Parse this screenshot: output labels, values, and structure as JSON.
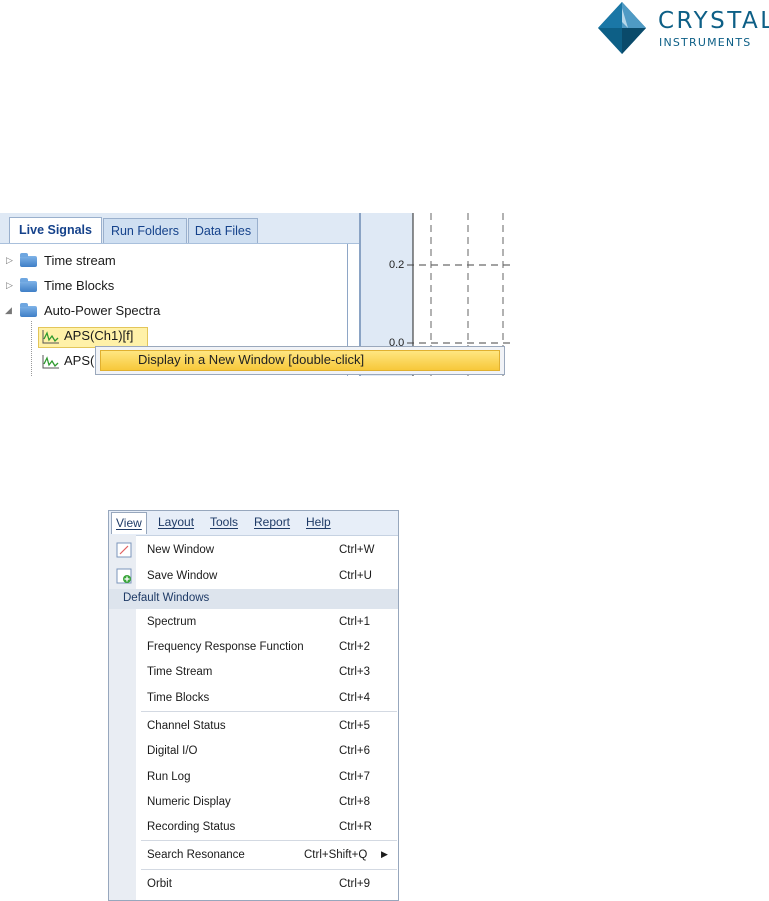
{
  "logo": {
    "line1": "CRYSTAL",
    "line2": "INSTRUMENTS"
  },
  "tree_panel": {
    "tabs": [
      "Live Signals",
      "Run Folders",
      "Data Files"
    ],
    "active_tab": "Live Signals",
    "items": [
      {
        "label": "Time stream",
        "expander": "▷"
      },
      {
        "label": "Time Blocks",
        "expander": "▷"
      },
      {
        "label": "Auto-Power Spectra",
        "expander": "◢"
      },
      {
        "label": "APS(Ch1)[f]"
      },
      {
        "label": "APS("
      }
    ],
    "plot": {
      "yticks": [
        "0.2",
        "0.0"
      ]
    },
    "context_menu": {
      "item": "Display in a New Window [double-click]"
    }
  },
  "view_menu": {
    "menubar": [
      "View",
      "Layout",
      "Tools",
      "Report",
      "Help"
    ],
    "open_menu": "View",
    "top_items": [
      {
        "label": "New Window",
        "shortcut": "Ctrl+W",
        "icon": "new-window-icon"
      },
      {
        "label": "Save Window",
        "shortcut": "Ctrl+U",
        "icon": "save-window-icon"
      }
    ],
    "section_header": "Default Windows",
    "items": [
      {
        "label": "Spectrum",
        "shortcut": "Ctrl+1"
      },
      {
        "label": "Frequency Response Function",
        "shortcut": "Ctrl+2"
      },
      {
        "label": "Time Stream",
        "shortcut": "Ctrl+3"
      },
      {
        "label": "Time Blocks",
        "shortcut": "Ctrl+4"
      },
      {
        "label": "Channel Status",
        "shortcut": "Ctrl+5"
      },
      {
        "label": "Digital I/O",
        "shortcut": "Ctrl+6"
      },
      {
        "label": "Run Log",
        "shortcut": "Ctrl+7"
      },
      {
        "label": "Numeric Display",
        "shortcut": "Ctrl+8"
      },
      {
        "label": "Recording Status",
        "shortcut": "Ctrl+R"
      },
      {
        "label": "Search Resonance",
        "shortcut": "Ctrl+Shift+Q",
        "submenu": "▶"
      },
      {
        "label": "Orbit",
        "shortcut": "Ctrl+9"
      }
    ]
  },
  "colors": {
    "brand": "#0d5f86",
    "highlight": "#f7c83a",
    "tab_text": "#15428b"
  }
}
